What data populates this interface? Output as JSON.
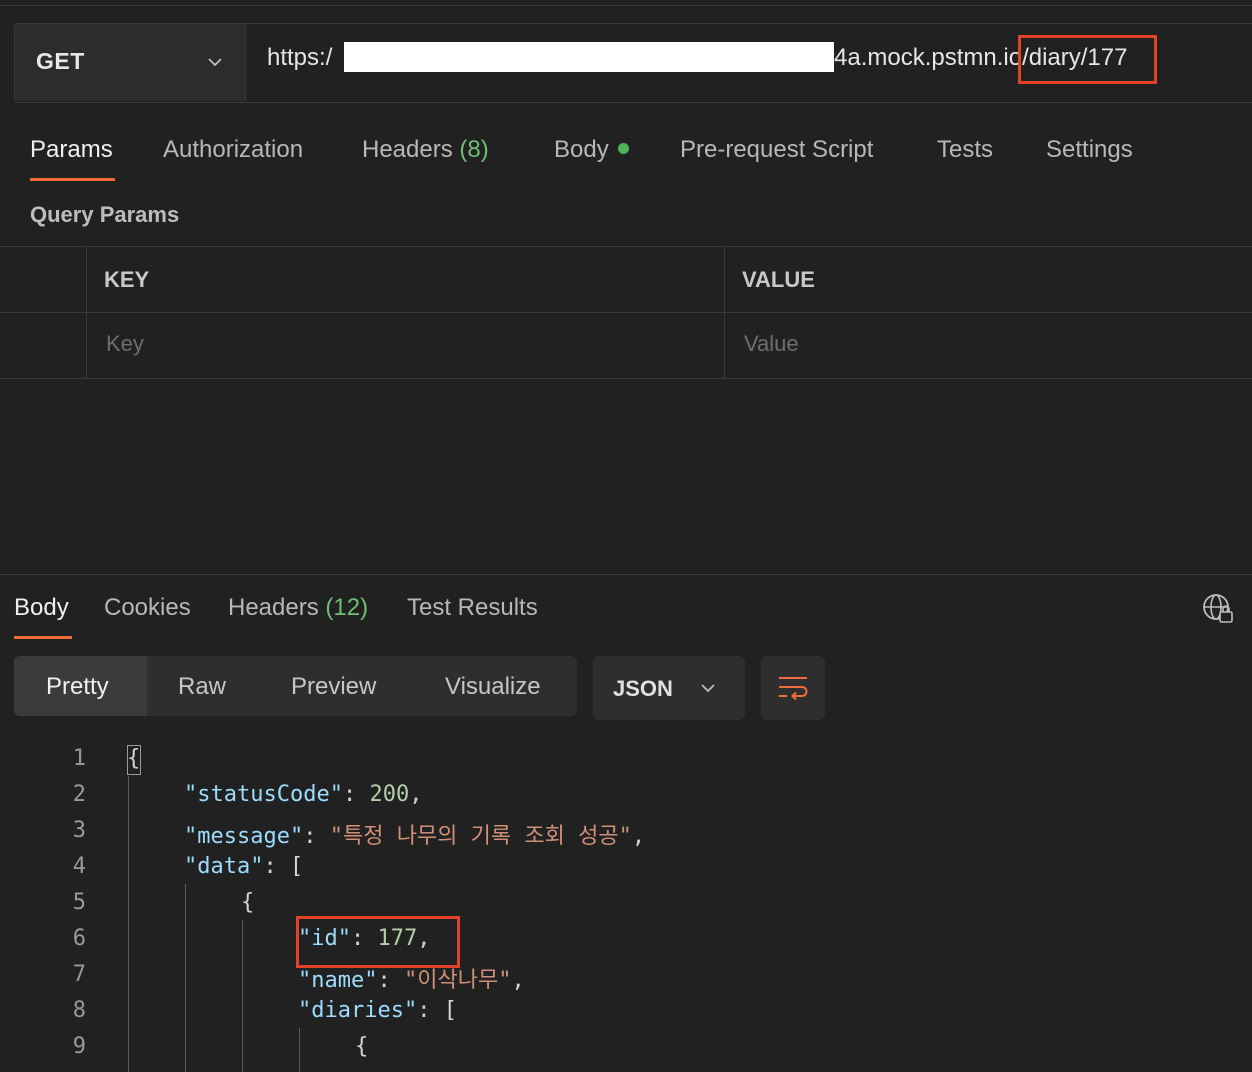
{
  "request": {
    "method": "GET",
    "url_prefix": "https:/",
    "url_suffix": "4a.mock.pstmn.io/diary/177"
  },
  "request_tabs": {
    "params": "Params",
    "authorization": "Authorization",
    "headers": "Headers",
    "headers_count": "(8)",
    "body": "Body",
    "pre_request": "Pre-request Script",
    "tests": "Tests",
    "settings": "Settings"
  },
  "query_params": {
    "title": "Query Params",
    "key_header": "KEY",
    "value_header": "VALUE",
    "key_placeholder": "Key",
    "value_placeholder": "Value"
  },
  "response_tabs": {
    "body": "Body",
    "cookies": "Cookies",
    "headers": "Headers",
    "headers_count": "(12)",
    "test_results": "Test Results"
  },
  "view": {
    "pretty": "Pretty",
    "raw": "Raw",
    "preview": "Preview",
    "visualize": "Visualize",
    "format": "JSON"
  },
  "code": {
    "line_numbers": [
      "1",
      "2",
      "3",
      "4",
      "5",
      "6",
      "7",
      "8",
      "9"
    ],
    "l1": "{",
    "l2_key": "\"statusCode\"",
    "l2_colon": ": ",
    "l2_val": "200",
    "l2_end": ",",
    "l3_key": "\"message\"",
    "l3_colon": ": ",
    "l3_val": "\"특정 나무의 기록 조회 성공\"",
    "l3_end": ",",
    "l4_key": "\"data\"",
    "l4_rest": ": [",
    "l5": "{",
    "l6_key": "\"id\"",
    "l6_colon": ": ",
    "l6_val": "177",
    "l6_end": ",",
    "l7_key": "\"name\"",
    "l7_colon": ": ",
    "l7_val": "\"이삭나무\"",
    "l7_end": ",",
    "l8_key": "\"diaries\"",
    "l8_rest": ": [",
    "l9": "{"
  }
}
